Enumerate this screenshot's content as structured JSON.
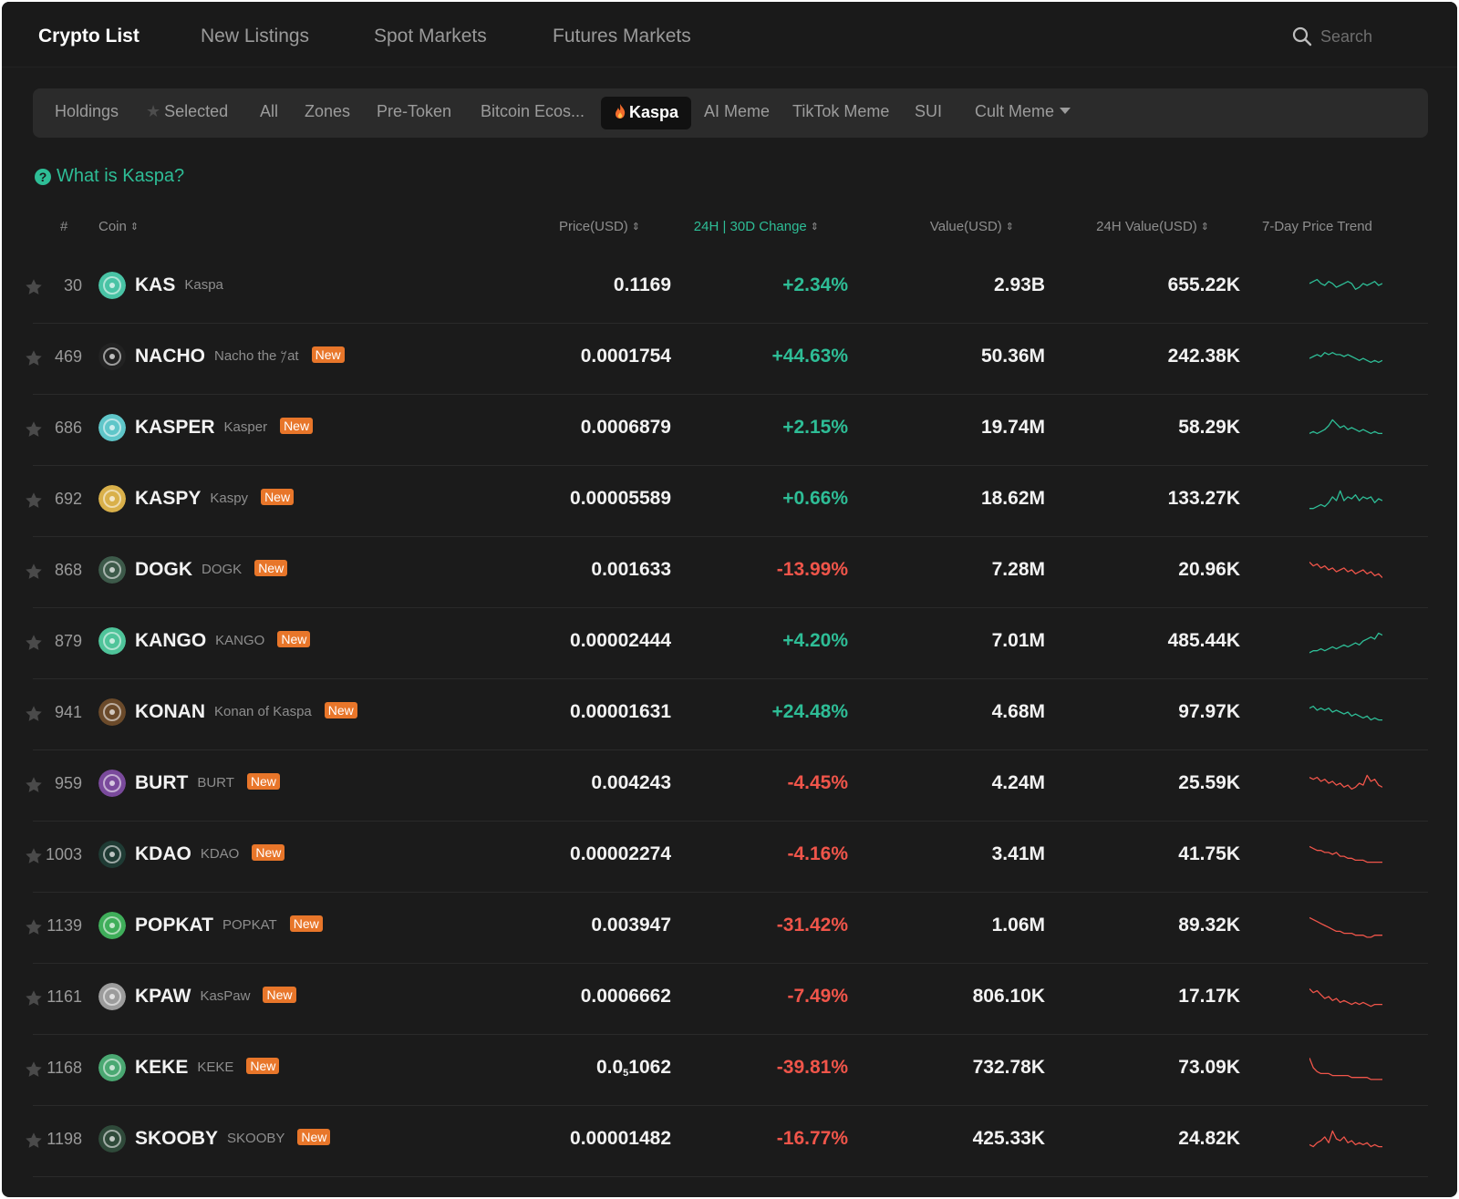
{
  "nav": {
    "tabs": [
      {
        "label": "Crypto List",
        "active": true
      },
      {
        "label": "New Listings",
        "active": false
      },
      {
        "label": "Spot Markets",
        "active": false
      },
      {
        "label": "Futures Markets",
        "active": false
      }
    ],
    "search_placeholder": "Search"
  },
  "categories": [
    {
      "label": "Holdings"
    },
    {
      "label": "Selected",
      "icon": "star-icon"
    },
    {
      "label": "All"
    },
    {
      "label": "Zones"
    },
    {
      "label": "Pre-Token"
    },
    {
      "label": "Bitcoin Ecos..."
    },
    {
      "label": "Kaspa",
      "icon": "fire-icon",
      "active": true
    },
    {
      "label": "AI Meme"
    },
    {
      "label": "TikTok Meme"
    },
    {
      "label": "SUI"
    },
    {
      "label": "Cult Meme",
      "icon": "caret-down-icon"
    }
  ],
  "info_link": "What is Kaspa?",
  "table": {
    "headers": {
      "rank": "#",
      "coin": "Coin",
      "price": "Price(USD)",
      "change": "24H | 30D Change",
      "value": "Value(USD)",
      "value24": "24H Value(USD)",
      "trend": "7-Day Price Trend"
    },
    "badge_label": "New",
    "rows": [
      {
        "rank": "30",
        "symbol": "KAS",
        "name": "Kaspa",
        "new": false,
        "price": "0.1169",
        "change": "+2.34%",
        "dir": "up",
        "value": "2.93B",
        "value24": "655.22K",
        "logo_color": "#49c3a5",
        "trend": [
          6,
          5,
          4,
          6,
          7,
          5,
          6,
          8,
          7,
          6,
          5,
          6,
          9,
          8,
          6,
          7,
          6,
          5,
          7,
          6
        ]
      },
      {
        "rank": "469",
        "symbol": "NACHO",
        "name": "Nacho the 𐤊at",
        "new": true,
        "price": "0.0001754",
        "change": "+44.63%",
        "dir": "up",
        "value": "50.36M",
        "value24": "242.38K",
        "logo_color": "#222222",
        "trend": [
          8,
          7,
          6,
          7,
          5,
          6,
          5,
          6,
          6,
          7,
          6,
          7,
          8,
          9,
          8,
          9,
          10,
          9,
          10,
          9
        ]
      },
      {
        "rank": "686",
        "symbol": "KASPER",
        "name": "Kasper",
        "new": true,
        "price": "0.0006879",
        "change": "+2.15%",
        "dir": "up",
        "value": "19.74M",
        "value24": "58.29K",
        "logo_color": "#5fc6c9",
        "trend": [
          10,
          9,
          10,
          9,
          8,
          6,
          3,
          5,
          7,
          6,
          8,
          7,
          8,
          9,
          8,
          9,
          10,
          9,
          10,
          10
        ]
      },
      {
        "rank": "692",
        "symbol": "KASPY",
        "name": "Kaspy",
        "new": true,
        "price": "0.00005589",
        "change": "+0.66%",
        "dir": "up",
        "value": "18.62M",
        "value24": "133.27K",
        "logo_color": "#d9b04a",
        "trend": [
          12,
          12,
          11,
          10,
          11,
          9,
          6,
          8,
          3,
          8,
          6,
          7,
          5,
          8,
          6,
          7,
          6,
          9,
          7,
          8
        ]
      },
      {
        "rank": "868",
        "symbol": "DOGK",
        "name": "DOGK",
        "new": true,
        "price": "0.001633",
        "change": "-13.99%",
        "dir": "down",
        "value": "7.28M",
        "value24": "20.96K",
        "logo_color": "#3d5a4a",
        "trend": [
          3,
          5,
          4,
          6,
          5,
          7,
          6,
          8,
          7,
          6,
          8,
          7,
          9,
          8,
          7,
          9,
          8,
          10,
          9,
          11
        ]
      },
      {
        "rank": "879",
        "symbol": "KANGO",
        "name": "KANGO",
        "new": true,
        "price": "0.00002444",
        "change": "+4.20%",
        "dir": "up",
        "value": "7.01M",
        "value24": "485.44K",
        "logo_color": "#4fc49a",
        "trend": [
          13,
          12,
          12,
          11,
          12,
          11,
          10,
          11,
          10,
          9,
          10,
          9,
          8,
          9,
          7,
          6,
          5,
          6,
          3,
          4
        ]
      },
      {
        "rank": "941",
        "symbol": "KONAN",
        "name": "Konan of Kaspa",
        "new": true,
        "price": "0.00001631",
        "change": "+24.48%",
        "dir": "up",
        "value": "4.68M",
        "value24": "97.97K",
        "logo_color": "#6b4a2a",
        "trend": [
          5,
          4,
          6,
          5,
          6,
          5,
          7,
          6,
          7,
          8,
          7,
          9,
          8,
          9,
          10,
          9,
          11,
          10,
          11,
          11
        ]
      },
      {
        "rank": "959",
        "symbol": "BURT",
        "name": "BURT",
        "new": true,
        "price": "0.004243",
        "change": "-4.45%",
        "dir": "down",
        "value": "4.24M",
        "value24": "25.59K",
        "logo_color": "#7a4a9c",
        "trend": [
          4,
          5,
          4,
          6,
          5,
          7,
          6,
          8,
          7,
          9,
          8,
          10,
          9,
          7,
          8,
          3,
          6,
          5,
          8,
          9
        ]
      },
      {
        "rank": "1003",
        "symbol": "KDAO",
        "name": "KDAO",
        "new": true,
        "price": "0.00002274",
        "change": "-4.16%",
        "dir": "down",
        "value": "3.41M",
        "value24": "41.75K",
        "logo_color": "#1f3b34",
        "trend": [
          3,
          4,
          5,
          5,
          6,
          6,
          7,
          6,
          8,
          8,
          9,
          9,
          10,
          10,
          10,
          11,
          11,
          11,
          11,
          11
        ]
      },
      {
        "rank": "1139",
        "symbol": "POPKAT",
        "name": "POPKAT",
        "new": true,
        "price": "0.003947",
        "change": "-31.42%",
        "dir": "down",
        "value": "1.06M",
        "value24": "89.32K",
        "logo_color": "#3fae5a",
        "trend": [
          3,
          4,
          5,
          6,
          7,
          8,
          9,
          10,
          10,
          11,
          11,
          11,
          12,
          12,
          12,
          13,
          13,
          12,
          12,
          12
        ]
      },
      {
        "rank": "1161",
        "symbol": "KPAW",
        "name": "KasPaw",
        "new": true,
        "price": "0.0006662",
        "change": "-7.49%",
        "dir": "down",
        "value": "806.10K",
        "value24": "17.17K",
        "logo_color": "#9c9c9c",
        "trend": [
          3,
          5,
          4,
          6,
          8,
          7,
          9,
          8,
          10,
          9,
          10,
          11,
          10,
          11,
          10,
          11,
          12,
          11,
          11,
          11
        ]
      },
      {
        "rank": "1168",
        "symbol": "KEKE",
        "name": "KEKE",
        "new": true,
        "price": "0.0",
        "price_sub": "5",
        "price_tail": "1062",
        "change": "-39.81%",
        "dir": "down",
        "value": "732.78K",
        "value24": "73.09K",
        "logo_color": "#4aa872",
        "trend": [
          2,
          7,
          9,
          10,
          10,
          10,
          11,
          11,
          11,
          11,
          11,
          12,
          12,
          12,
          12,
          12,
          13,
          13,
          13,
          13
        ]
      },
      {
        "rank": "1198",
        "symbol": "SKOOBY",
        "name": "SKOOBY",
        "new": true,
        "price": "0.00001482",
        "change": "-16.77%",
        "dir": "down",
        "value": "425.33K",
        "value24": "24.82K",
        "logo_color": "#2f4a3a",
        "trend": [
          10,
          11,
          9,
          8,
          6,
          9,
          3,
          7,
          8,
          6,
          9,
          8,
          10,
          9,
          10,
          9,
          11,
          10,
          11,
          11
        ]
      }
    ]
  },
  "colors": {
    "up": "#2ebd96",
    "down": "#f0554a",
    "badge": "#e8762a",
    "accent": "#2ebd96"
  }
}
